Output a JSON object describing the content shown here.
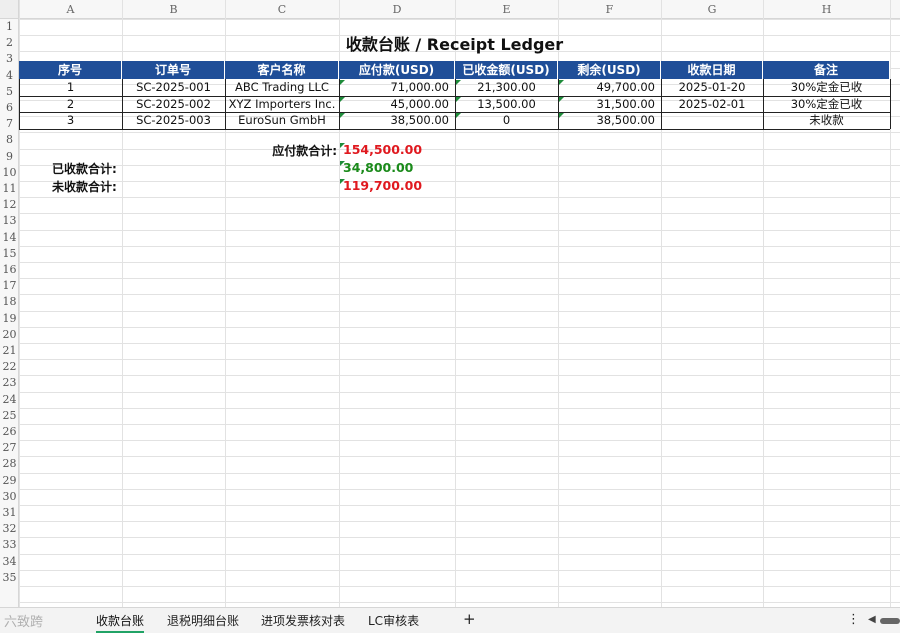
{
  "sheet": {
    "columns": [
      "A",
      "B",
      "C",
      "D",
      "E",
      "F",
      "G",
      "H"
    ],
    "rows": [
      "1",
      "2",
      "3",
      "4",
      "5",
      "6",
      "7",
      "8",
      "9",
      "10",
      "11",
      "12",
      "13",
      "14",
      "15",
      "16",
      "17",
      "18",
      "19",
      "20",
      "21",
      "22",
      "23",
      "24",
      "25",
      "26",
      "27",
      "28",
      "29",
      "30",
      "31",
      "32",
      "33",
      "34",
      "35"
    ],
    "title": "收款台账 / Receipt Ledger",
    "headers": [
      "序号",
      "订单号",
      "客户名称",
      "应付款(USD)",
      "已收金额(USD)",
      "剩余(USD)",
      "收款日期",
      "备注"
    ],
    "data_rows": [
      [
        "1",
        "SC-2025-001",
        "ABC Trading LLC",
        "71,000.00",
        "21,300.00",
        "49,700.00",
        "2025-01-20",
        "30%定金已收"
      ],
      [
        "2",
        "SC-2025-002",
        "XYZ Importers Inc.",
        "45,000.00",
        "13,500.00",
        "31,500.00",
        "2025-02-01",
        "30%定金已收"
      ],
      [
        "3",
        "SC-2025-003",
        "EuroSun GmbH",
        "38,500.00",
        "0",
        "38,500.00",
        "",
        "未收款"
      ]
    ],
    "summary": {
      "payable_label": "应付款合计:",
      "payable_value": "154,500.00",
      "received_label": "已收款合计:",
      "received_value": "34,800.00",
      "outstanding_label": "未收款合计:",
      "outstanding_value": "119,700.00"
    },
    "colors": {
      "header_bg": "#1f4e98",
      "red_value": "#e0191f",
      "green_value": "#1a8a1a"
    }
  },
  "tabs": {
    "items": [
      "收款台账",
      "退税明细台账",
      "进项发票核对表",
      "LC审核表"
    ],
    "active": "收款台账",
    "add_label": "+",
    "more_label": "⋮",
    "scroll_left_label": "◀",
    "watermark": "六致跨"
  }
}
